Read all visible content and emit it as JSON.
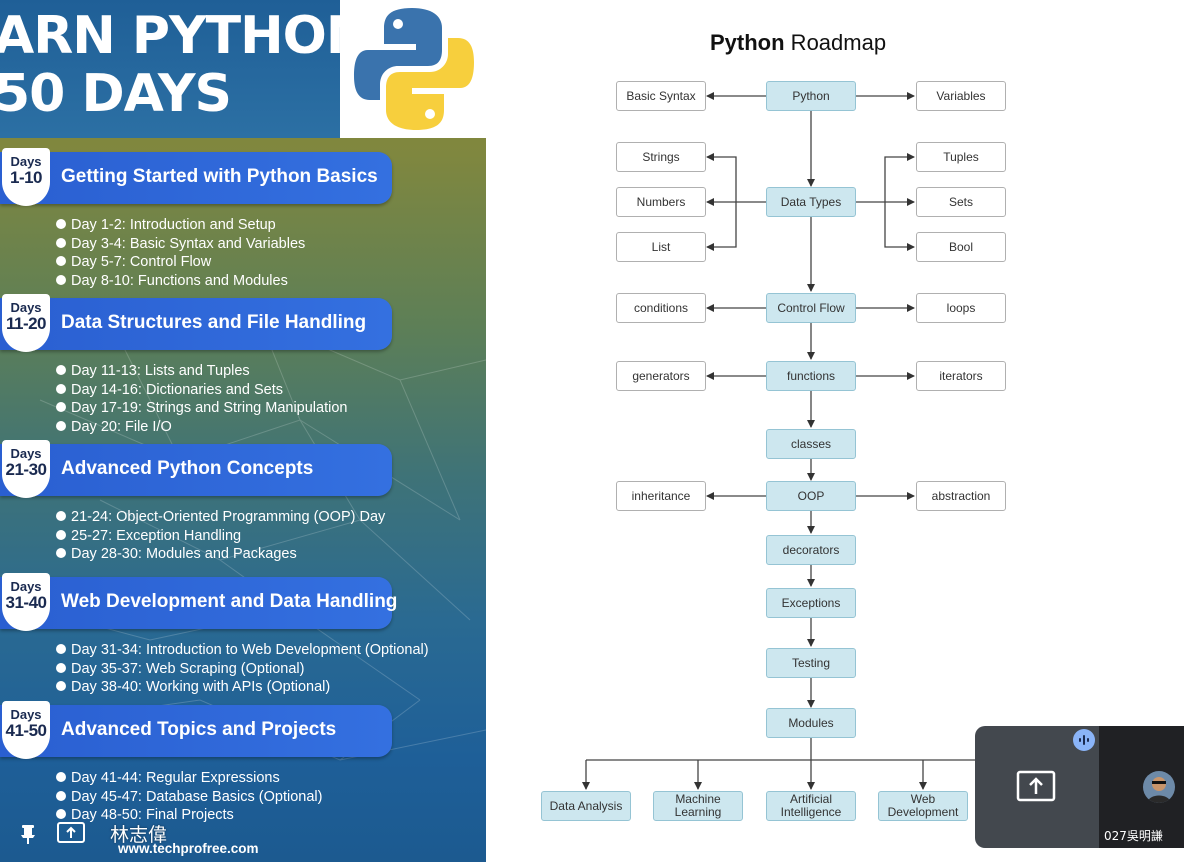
{
  "poster": {
    "headline_line1": "ARN PYTHON",
    "headline_line2": "50 DAYS",
    "logo_icon": "python-logo",
    "sections": [
      {
        "days_label": "Days",
        "days_range": "1-10",
        "title": "Getting Started with Python Basics",
        "items": [
          "Day 1-2: Introduction and Setup",
          "Day 3-4: Basic Syntax and Variables",
          "Day 5-7: Control Flow",
          "Day 8-10: Functions and Modules"
        ]
      },
      {
        "days_label": "Days",
        "days_range": "11-20",
        "title": "Data Structures and File Handling",
        "items": [
          "Day 11-13: Lists and Tuples",
          "Day 14-16: Dictionaries and Sets",
          "Day 17-19: Strings and String Manipulation",
          "Day 20: File I/O"
        ]
      },
      {
        "days_label": "Days",
        "days_range": "21-30",
        "title": "Advanced Python Concepts",
        "items": [
          "21-24: Object-Oriented Programming (OOP) Day",
          "25-27: Exception Handling",
          "Day 28-30: Modules and Packages"
        ]
      },
      {
        "days_label": "Days",
        "days_range": "31-40",
        "title": "Web Development and Data Handling",
        "items": [
          "Day 31-34: Introduction to Web Development (Optional)",
          "Day 35-37: Web Scraping (Optional)",
          "Day 38-40: Working with APIs (Optional)"
        ]
      },
      {
        "days_label": "Days",
        "days_range": "41-50",
        "title": "Advanced Topics and Projects",
        "items": [
          "Day 41-44: Regular Expressions",
          "Day 45-47: Database Basics (Optional)",
          "Day 48-50: Final Projects"
        ]
      }
    ],
    "website": "www.techprofree.com"
  },
  "roadmap": {
    "title_bold": "Python",
    "title_rest": " Roadmap",
    "nodes": {
      "python": "Python",
      "basic_syntax": "Basic Syntax",
      "variables": "Variables",
      "strings": "Strings",
      "numbers": "Numbers",
      "list": "List",
      "data_types": "Data Types",
      "tuples": "Tuples",
      "sets": "Sets",
      "bool": "Bool",
      "conditions": "conditions",
      "control_flow": "Control Flow",
      "loops": "loops",
      "generators": "generators",
      "functions": "functions",
      "iterators": "iterators",
      "classes": "classes",
      "inheritance": "inheritance",
      "oop": "OOP",
      "abstraction": "abstraction",
      "decorators": "decorators",
      "exceptions": "Exceptions",
      "testing": "Testing",
      "modules": "Modules",
      "data_analysis": "Data Analysis",
      "machine_learning": "Machine Learning",
      "artificial_intelligence": "Artificial Intelligence",
      "web_development": "Web Development"
    }
  },
  "meeting": {
    "presenter_name": "林志偉",
    "participant_name": "027吳明謙",
    "pin_icon": "pin-icon",
    "present_icon": "present-screen-icon",
    "mic_icon": "speaking-indicator-icon",
    "accent_color": "#8ab4f8"
  }
}
